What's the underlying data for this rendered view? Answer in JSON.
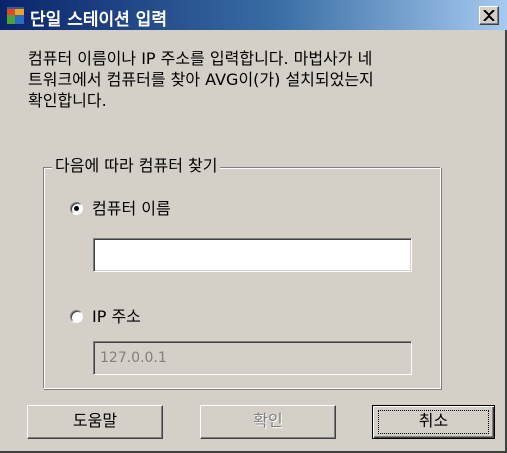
{
  "window": {
    "title": "단일 스테이션 입력",
    "close_icon": "close-x-icon",
    "app_icon": "avg-logo-icon"
  },
  "description": "컴퓨터 이름이나 IP 주소를 입력합니다. 마법사가 네\n트워크에서 컴퓨터를 찾아 AVG이(가) 설치되었는지\n확인합니다.",
  "group": {
    "legend": "다음에 따라 컴퓨터 찾기",
    "options": [
      {
        "label": "컴퓨터 이름",
        "selected": true
      },
      {
        "label": "IP 주소",
        "selected": false
      }
    ],
    "computer_name": {
      "value": ""
    },
    "ip_address": {
      "value": "127.0.0.1"
    }
  },
  "buttons": {
    "help": "도움말",
    "ok": "확인",
    "cancel": "취소"
  },
  "colors": {
    "title_start": "#0a246a",
    "title_end": "#a6caf0",
    "face": "#d4d0c8"
  }
}
